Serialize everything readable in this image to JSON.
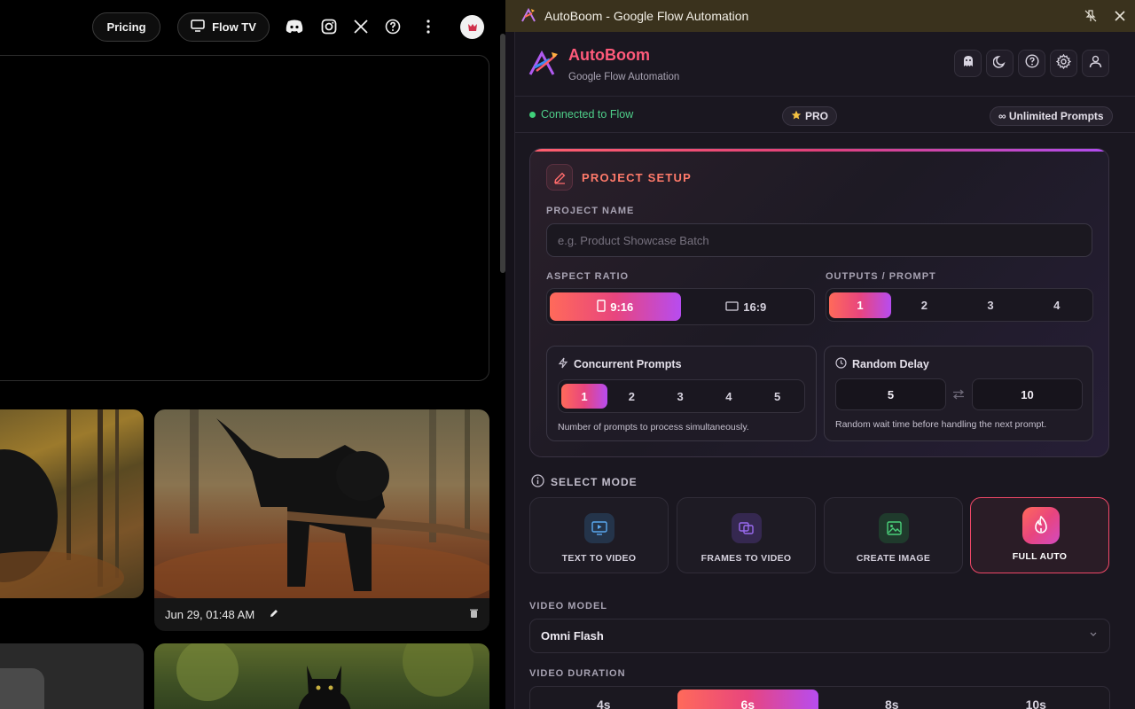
{
  "flow_page": {
    "header": {
      "pricing_label": "Pricing",
      "flowtv_label": "Flow TV",
      "icons": [
        "discord-icon",
        "instagram-icon",
        "x-icon",
        "help-icon",
        "more-vert-icon",
        "avatar"
      ]
    },
    "cards": [
      {
        "date": "Jun 29, 01:48 AM"
      }
    ]
  },
  "window": {
    "title": "AutoBoom - Google Flow Automation"
  },
  "extension": {
    "brand": {
      "name": "AutoBoom",
      "subtitle": "Google Flow Automation"
    },
    "status": {
      "connected": "Connected to Flow",
      "plan": "PRO",
      "prompts": "∞ Unlimited Prompts"
    },
    "project_setup": {
      "title": "PROJECT SETUP",
      "project_name_label": "PROJECT NAME",
      "project_name_placeholder": "e.g. Product Showcase Batch",
      "project_name_value": "",
      "aspect_ratio_label": "ASPECT RATIO",
      "aspect_ratio_options": [
        "9:16",
        "16:9"
      ],
      "aspect_ratio_selected": "9:16",
      "outputs_label": "OUTPUTS / PROMPT",
      "outputs_options": [
        "1",
        "2",
        "3",
        "4"
      ],
      "outputs_selected": "1",
      "concurrent": {
        "title": "Concurrent Prompts",
        "options": [
          "1",
          "2",
          "3",
          "4",
          "5"
        ],
        "selected": "1",
        "note": "Number of prompts to process simultaneously."
      },
      "random_delay": {
        "title": "Random Delay",
        "min": "5",
        "max": "10",
        "note": "Random wait time before handling the next prompt."
      }
    },
    "select_mode": {
      "label": "SELECT MODE",
      "modes": [
        "TEXT TO VIDEO",
        "FRAMES TO VIDEO",
        "CREATE IMAGE",
        "FULL AUTO"
      ],
      "selected": "FULL AUTO"
    },
    "video_model": {
      "label": "VIDEO MODEL",
      "value": "Omni Flash"
    },
    "video_duration": {
      "label": "VIDEO DURATION",
      "options": [
        "4s",
        "6s",
        "8s",
        "10s"
      ],
      "selected": "6s"
    }
  },
  "colors": {
    "accent_gradient": [
      "#ff6a5a",
      "#e8457e",
      "#b74cf0"
    ],
    "connected_green": "#4fd08a",
    "titlebar_bg": "#3a321d",
    "panel_bg": "#1a1720"
  }
}
